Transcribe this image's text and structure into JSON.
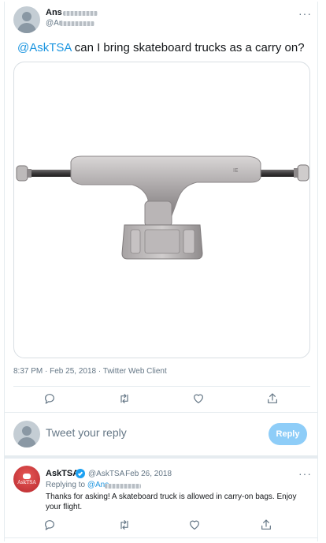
{
  "tweet": {
    "author_name": "Ans",
    "author_handle": "@An",
    "more_label": "···",
    "mention": "@AskTSA",
    "text": " can I bring skateboard trucks as a carry on?",
    "timestamp": "8:37 PM · Feb 25, 2018 · Twitter Web Client",
    "image_alt": "skateboard truck"
  },
  "actions": [
    "reply-icon",
    "retweet-icon",
    "like-icon",
    "share-icon"
  ],
  "composer": {
    "placeholder": "Tweet your reply",
    "button_label": "Reply"
  },
  "reply": {
    "author_name": "AskTSA",
    "author_handle": "@AskTSA",
    "date": " · Feb 26, 2018",
    "more_label": "···",
    "replying_to_label": "Replying to ",
    "replying_to_handle": "@Ans",
    "text_line1": "Thanks for asking! A skateboard truck is allowed in carry-on bags. Enjoy",
    "text_line2": "your flight.",
    "avatar_label": "AskTSA"
  },
  "colors": {
    "link": "#1b95e0",
    "muted": "#657786",
    "reply_button": "#8ecdf8",
    "tsa_red": "#c0272d"
  }
}
